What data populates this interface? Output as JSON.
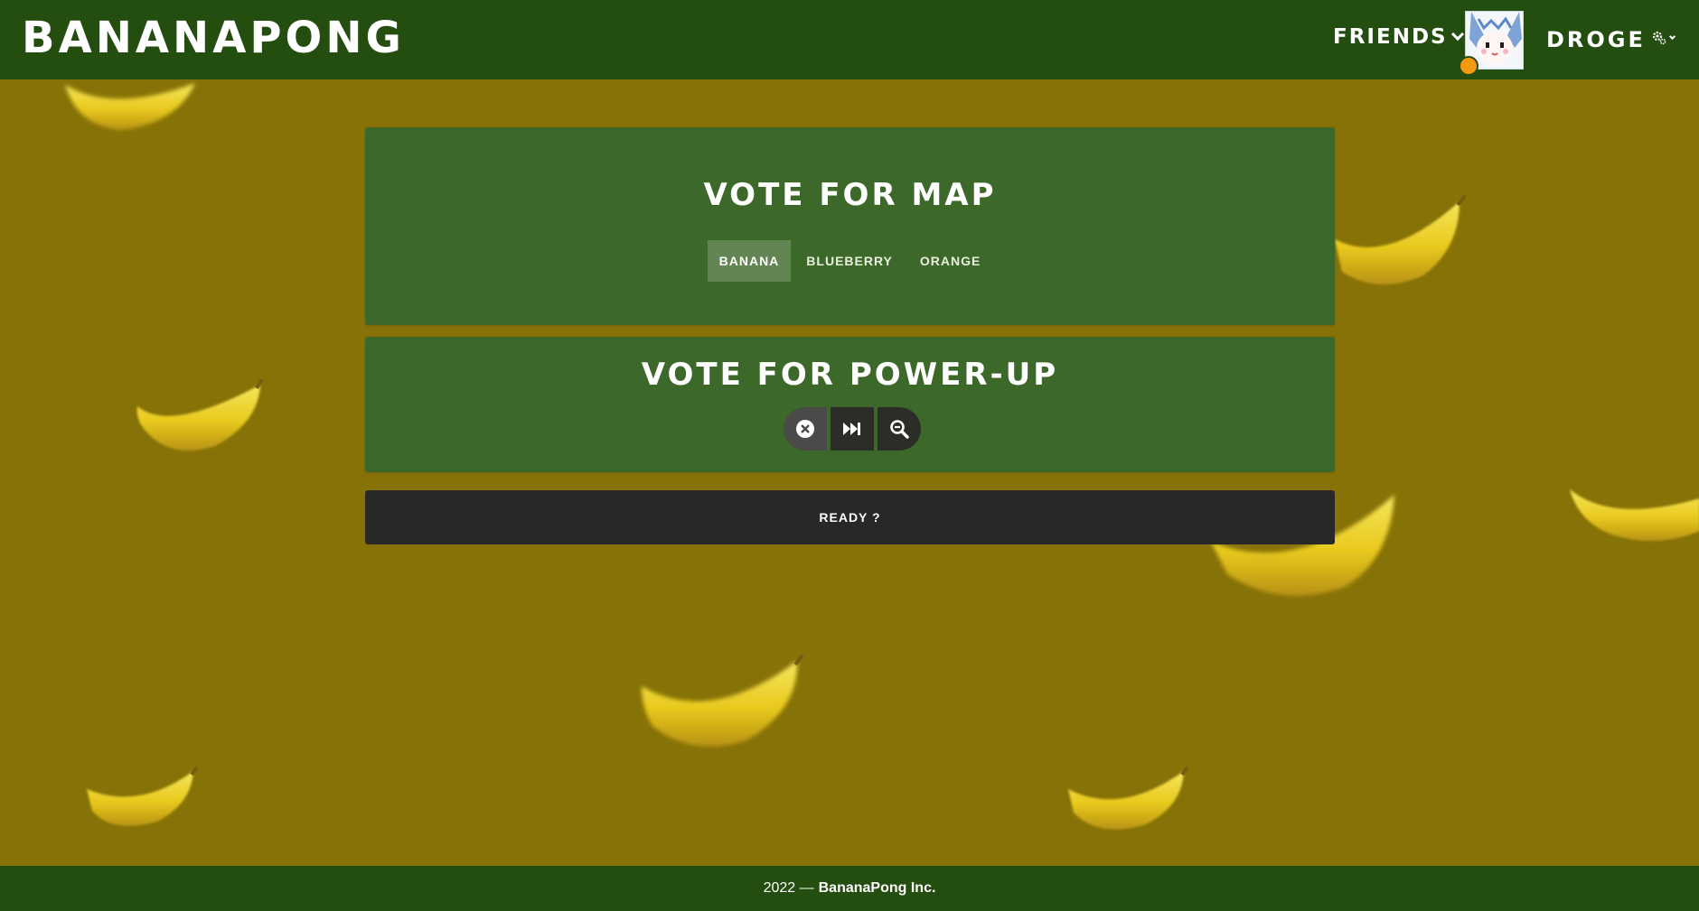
{
  "header": {
    "brand": "BANANAPONG",
    "friends_label": "FRIENDS",
    "username": "DROGE",
    "status_color": "#f59a10"
  },
  "map_vote": {
    "title": "VOTE FOR MAP",
    "options": [
      "BANANA",
      "BLUEBERRY",
      "ORANGE"
    ],
    "selected": "BANANA"
  },
  "powerup_vote": {
    "title": "VOTE FOR POWER-UP",
    "icons": [
      "close-circle-icon",
      "fast-forward-icon",
      "zoom-out-icon"
    ]
  },
  "ready_label": "READY ?",
  "footer": {
    "year": "2022 —",
    "company": "BananaPong Inc."
  },
  "colors": {
    "background": "#877207",
    "topbar": "#244d10",
    "panel": "#3c6829",
    "ready": "#282828"
  }
}
